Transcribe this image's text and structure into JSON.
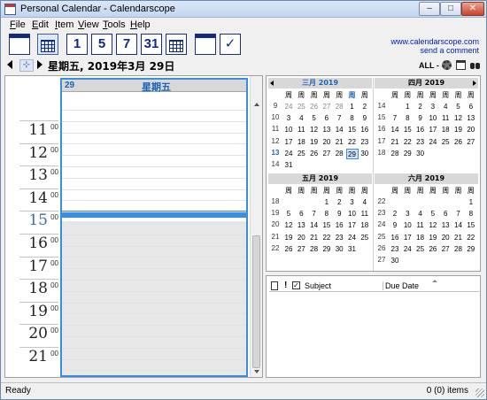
{
  "window": {
    "title": "Personal Calendar - Calendarscope"
  },
  "menu": [
    "File",
    "Edit",
    "Item",
    "View",
    "Tools",
    "Help"
  ],
  "toolbar": {
    "day1": "1",
    "day5": "5",
    "day7": "7",
    "day31": "31",
    "website": "www.calendarscope.com",
    "comment": "send a comment"
  },
  "nav": {
    "date": "星期五, 2019年3月 29日",
    "filter": "ALL -"
  },
  "day": {
    "num": "29",
    "weekday": "星期五",
    "current_hour": "15"
  },
  "hours": [
    "11",
    "12",
    "13",
    "14",
    "15",
    "16",
    "17",
    "18",
    "19",
    "20",
    "21"
  ],
  "minute_label": "00",
  "weekdays": [
    "周",
    "周",
    "周",
    "周",
    "周",
    "周",
    "周"
  ],
  "months": [
    {
      "title": "三月 2019",
      "blue": true,
      "weeks": [
        "9",
        "10",
        "11",
        "12",
        "13",
        "14"
      ],
      "rows": [
        [
          "24",
          "25",
          "26",
          "27",
          "28",
          "1",
          "2"
        ],
        [
          "3",
          "4",
          "5",
          "6",
          "7",
          "8",
          "9"
        ],
        [
          "10",
          "11",
          "12",
          "13",
          "14",
          "15",
          "16"
        ],
        [
          "17",
          "18",
          "19",
          "20",
          "21",
          "22",
          "23"
        ],
        [
          "24",
          "25",
          "26",
          "27",
          "28",
          "29",
          "30"
        ],
        [
          "31",
          "",
          "",
          "",
          "",
          "",
          ""
        ]
      ]
    },
    {
      "title": "四月 2019",
      "blue": false,
      "weeks": [
        "14",
        "15",
        "16",
        "17",
        "18"
      ],
      "rows": [
        [
          "",
          "1",
          "2",
          "3",
          "4",
          "5",
          "6"
        ],
        [
          "7",
          "8",
          "9",
          "10",
          "11",
          "12",
          "13"
        ],
        [
          "14",
          "15",
          "16",
          "17",
          "18",
          "19",
          "20"
        ],
        [
          "21",
          "22",
          "23",
          "24",
          "25",
          "26",
          "27"
        ],
        [
          "28",
          "29",
          "30",
          "",
          "",
          "",
          ""
        ]
      ]
    },
    {
      "title": "五月 2019",
      "blue": false,
      "weeks": [
        "18",
        "19",
        "20",
        "21",
        "22"
      ],
      "rows": [
        [
          "",
          "",
          "",
          "1",
          "2",
          "3",
          "4"
        ],
        [
          "5",
          "6",
          "7",
          "8",
          "9",
          "10",
          "11"
        ],
        [
          "12",
          "13",
          "14",
          "15",
          "16",
          "17",
          "18"
        ],
        [
          "19",
          "20",
          "21",
          "22",
          "23",
          "24",
          "25"
        ],
        [
          "26",
          "27",
          "28",
          "29",
          "30",
          "31",
          ""
        ]
      ]
    },
    {
      "title": "六月 2019",
      "blue": false,
      "weeks": [
        "22",
        "23",
        "24",
        "25",
        "26",
        "27"
      ],
      "rows": [
        [
          "",
          "",
          "",
          "",
          "",
          "",
          "1"
        ],
        [
          "2",
          "3",
          "4",
          "5",
          "6",
          "7",
          "8"
        ],
        [
          "9",
          "10",
          "11",
          "12",
          "13",
          "14",
          "15"
        ],
        [
          "16",
          "17",
          "18",
          "19",
          "20",
          "21",
          "22"
        ],
        [
          "23",
          "24",
          "25",
          "26",
          "27",
          "28",
          "29"
        ],
        [
          "30",
          "",
          "",
          "",
          "",
          "",
          ""
        ]
      ]
    }
  ],
  "selected_day": "29",
  "tasks": {
    "subject": "Subject",
    "due": "Due Date"
  },
  "status": {
    "text": "Ready",
    "count": "0 (0) items"
  }
}
